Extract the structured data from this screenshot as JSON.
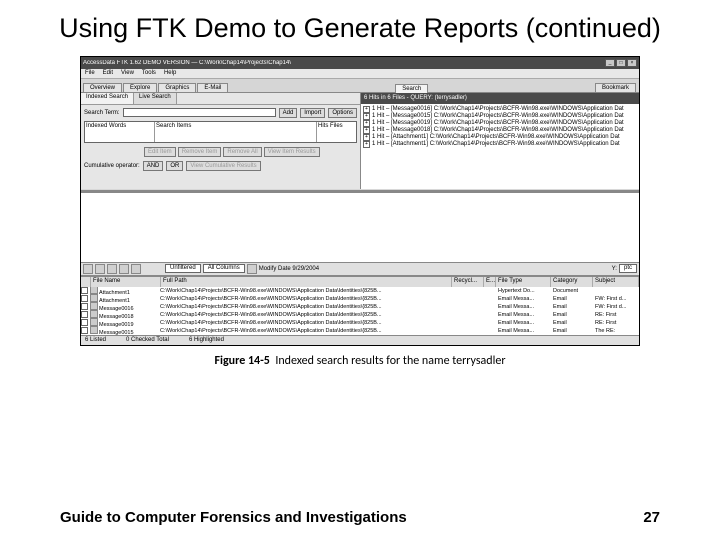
{
  "slide": {
    "title": "Using FTK Demo to Generate Reports (continued)",
    "footer_left": "Guide to Computer Forensics and Investigations",
    "footer_right": "27",
    "caption_label": "Figure 14-5",
    "caption_text": "Indexed search results for the name terrysadler"
  },
  "window": {
    "title": "AccessData FTK 1.62 DEMO VERSION — C:\\Work\\Chap14\\Projects\\Chap14\\",
    "minimize": "_",
    "maximize": "□",
    "close": "×"
  },
  "menu": {
    "file": "File",
    "edit": "Edit",
    "view": "View",
    "tools": "Tools",
    "help": "Help"
  },
  "tabs": {
    "overview": "Overview",
    "explore": "Explore",
    "graphics": "Graphics",
    "email": "E-Mail",
    "search": "Search",
    "bookmark": "Bookmark"
  },
  "subtabs": {
    "indexed": "Indexed Search",
    "live": "Live Search"
  },
  "search": {
    "term_label": "Search Term:",
    "add": "Add",
    "import": "Import",
    "options": "Options",
    "list_hdr1": "Indexed Words",
    "list_hdr2": "Search Items",
    "list_hdr3": "Hits",
    "list_hdr4": "Files"
  },
  "buttons": {
    "edit_item": "Edit Item",
    "remove_item": "Remove Item",
    "remove_all": "Remove All",
    "view_item": "View Item Results",
    "cumop": "Cumulative operator:",
    "and": "AND",
    "or": "OR",
    "view_cum": "View Cumulative Results"
  },
  "files_panel": {
    "header": "6 Hits in 6 Files - QUERY: (terrysadler)"
  },
  "tree": [
    {
      "exp": "+",
      "c": "1",
      "label": "[Message0016] C:\\Work\\Chap14\\Projects\\BCFR-Win98.exe\\WINDOWS\\Application Dat"
    },
    {
      "exp": "+",
      "c": "1",
      "label": "[Message0015] C:\\Work\\Chap14\\Projects\\BCFR-Win98.exe\\WINDOWS\\Application Dat"
    },
    {
      "exp": "+",
      "c": "1",
      "label": "[Message0019] C:\\Work\\Chap14\\Projects\\BCFR-Win98.exe\\WINDOWS\\Application Dat"
    },
    {
      "exp": "+",
      "c": "1",
      "label": "[Message0018] C:\\Work\\Chap14\\Projects\\BCFR-Win98.exe\\WINDOWS\\Application Dat"
    },
    {
      "exp": "+",
      "c": "1",
      "label": "[Attachment1] C:\\Work\\Chap14\\Projects\\BCFR-Win98.exe\\WINDOWS\\Application Dat"
    },
    {
      "exp": "+",
      "c": "1",
      "label": "[Attachment1] C:\\Work\\Chap14\\Projects\\BCFR-Win98.exe\\WINDOWS\\Application Dat"
    }
  ],
  "filters": {
    "unfiltered": "Unfiltered",
    "all_columns": "All Columns",
    "modify": "Modify Date 9/29/2004",
    "y": "Y:",
    "ptc": "ptc"
  },
  "table": {
    "cols": [
      "",
      "File Name",
      "Full Path",
      "Recycl...",
      "E...",
      "File Type",
      "Category",
      "Subject"
    ],
    "rows": [
      {
        "name": "Attachment1",
        "path": "C:\\Work\\Chap14\\Projects\\BCFR-Win98.exe\\WINDOWS\\Application Data\\Identities\\{825B...",
        "ft": "",
        "e": "",
        "type": "Hypertext Do...",
        "cat": "Document",
        "sub": ""
      },
      {
        "name": "Attachment1",
        "path": "C:\\Work\\Chap14\\Projects\\BCFR-Win98.exe\\WINDOWS\\Application Data\\Identities\\{825B...",
        "ft": "",
        "e": "",
        "type": "Email Messa...",
        "cat": "Email",
        "sub": "FW: First d..."
      },
      {
        "name": "Message0016",
        "path": "C:\\Work\\Chap14\\Projects\\BCFR-Win98.exe\\WINDOWS\\Application Data\\Identities\\{825B...",
        "ft": "",
        "e": "",
        "type": "Email Messa...",
        "cat": "Email",
        "sub": "FW: First d..."
      },
      {
        "name": "Message0018",
        "path": "C:\\Work\\Chap14\\Projects\\BCFR-Win98.exe\\WINDOWS\\Application Data\\Identities\\{825B...",
        "ft": "",
        "e": "",
        "type": "Email Messa...",
        "cat": "Email",
        "sub": "RE: First"
      },
      {
        "name": "Message0019",
        "path": "C:\\Work\\Chap14\\Projects\\BCFR-Win98.exe\\WINDOWS\\Application Data\\Identities\\{825B...",
        "ft": "",
        "e": "",
        "type": "Email Messa...",
        "cat": "Email",
        "sub": "RE: First"
      },
      {
        "name": "Message0015",
        "path": "C:\\Work\\Chap14\\Projects\\BCFR-Win98.exe\\WINDOWS\\Application Data\\Identities\\{825B...",
        "ft": "",
        "e": "",
        "type": "Email Messa...",
        "cat": "Email",
        "sub": "The RE:"
      }
    ]
  },
  "status": {
    "listed": "6 Listed",
    "checked": "0 Checked Total",
    "highlighted": "6 Highlighted"
  }
}
